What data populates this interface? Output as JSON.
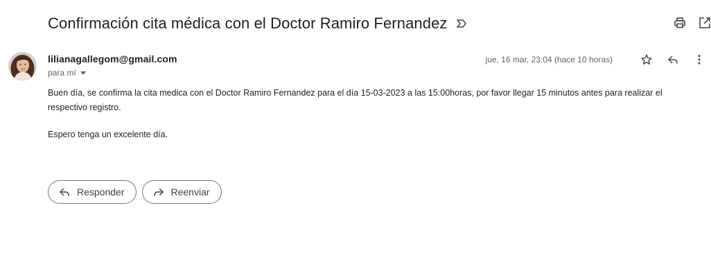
{
  "email": {
    "subject": "Confirmación cita médica con el Doctor Ramiro Fernandez",
    "sender": "lilianagallegom@gmail.com",
    "recipient_label": "para mí",
    "date": "jue, 16 mar, 23:04 (hace 10 horas)",
    "body": [
      "Buen día, se confirma la cita medica con el Doctor Ramiro Fernandez para el día 15-03-2023 a las  15:00horas, por favor llegar 15 minutos antes para realizar el respectivo registro.",
      "Espero tenga un excelente día."
    ]
  },
  "actions": {
    "reply_label": "Responder",
    "forward_label": "Reenviar"
  },
  "icons": {
    "important": "important-marker-icon",
    "print": "print-icon",
    "open_new_window": "open-in-new-window-icon",
    "star": "star-icon",
    "reply": "reply-icon",
    "more": "more-vertical-icon",
    "forward": "forward-icon"
  },
  "colors": {
    "text": "#1f1f1f",
    "secondary_text": "#5f6368",
    "button_border": "#747775"
  }
}
